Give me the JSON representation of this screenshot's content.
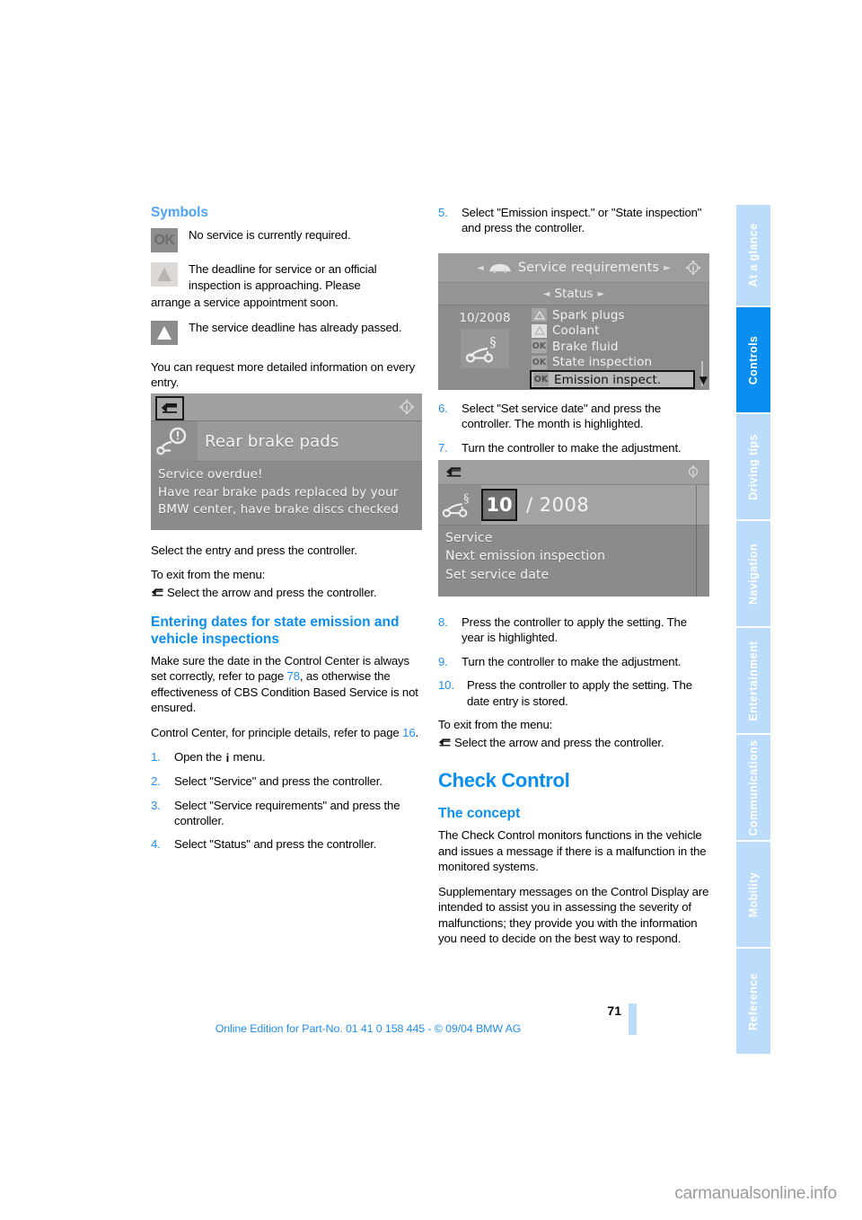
{
  "document": {
    "page_number": "71",
    "footer_line": "Online Edition for Part-No. 01 41 0 158 445 - © 09/04 BMW AG",
    "watermark": "carmanualsonline.info"
  },
  "tabs": [
    {
      "label": "At a glance",
      "active": false
    },
    {
      "label": "Controls",
      "active": true
    },
    {
      "label": "Driving tips",
      "active": false
    },
    {
      "label": "Navigation",
      "active": false
    },
    {
      "label": "Entertainment",
      "active": false
    },
    {
      "label": "Communications",
      "active": false
    },
    {
      "label": "Mobility",
      "active": false
    },
    {
      "label": "Reference",
      "active": false
    }
  ],
  "left_column": {
    "symbols_heading": "Symbols",
    "symbols": [
      {
        "icon": "ok-badge-icon",
        "glyph": "OK",
        "text": "No service is currently required."
      },
      {
        "icon": "warning-triangle-pale-icon",
        "glyph": "",
        "text": "The deadline for service or an official inspection is approaching. Please"
      },
      {
        "icon": "warning-triangle-icon",
        "glyph": "",
        "text": "The service deadline has already passed."
      }
    ],
    "symbol2_overflow": "arrange a service appointment soon.",
    "detail_note": "You can request more detailed information on every entry.",
    "shot1": {
      "title": "Rear brake pads",
      "message_line1": "Service overdue!",
      "message_line2": "Have rear brake pads replaced by your",
      "message_line3": "BMW center, have brake discs checked"
    },
    "after_shot1_1": "Select the entry and press the controller.",
    "after_shot1_2": "To exit from the menu:",
    "after_shot1_3": "Select the arrow and press the controller.",
    "entering_heading": "Entering dates for state emission and vehicle inspections",
    "para1_a": "Make sure the date in the Control Center is always set correctly, refer to page ",
    "para1_page": "78",
    "para1_b": ", as otherwise the effectiveness of CBS Condition Based Service is not ensured.",
    "para2_a": "Control Center, for principle details, refer to page ",
    "para2_page": "16",
    "para2_b": ".",
    "steps": [
      {
        "num": "1.",
        "text_before": "Open the ",
        "icon": "info-i-icon",
        "text_after": " menu."
      },
      {
        "num": "2.",
        "text": "Select \"Service\" and press the controller."
      },
      {
        "num": "3.",
        "text": "Select \"Service requirements\" and press the controller."
      },
      {
        "num": "4.",
        "text": "Select \"Status\" and press the controller."
      }
    ]
  },
  "right_column": {
    "step5": {
      "num": "5.",
      "text": "Select \"Emission inspect.\" or \"State inspection\" and press the controller."
    },
    "shot2": {
      "header": "Service requirements",
      "subheader": "Status",
      "date": "10/2008",
      "items": [
        {
          "badge": "warning",
          "badge_text": "",
          "label": "Spark plugs"
        },
        {
          "badge": "warning-pale",
          "badge_text": "",
          "label": "Coolant"
        },
        {
          "badge": "ok",
          "badge_text": "OK",
          "label": "Brake fluid"
        },
        {
          "badge": "ok",
          "badge_text": "OK",
          "label": "State inspection"
        },
        {
          "badge": "ok",
          "badge_text": "OK",
          "label": "Emission inspect.",
          "selected": true
        }
      ]
    },
    "step6": {
      "num": "6.",
      "text": "Select \"Set service date\" and press the controller. The month is highlighted."
    },
    "step7": {
      "num": "7.",
      "text": "Turn the controller to make the adjustment."
    },
    "shot3": {
      "month": "10",
      "year": "/ 2008",
      "menu": [
        "Service",
        "Next emission inspection",
        "Set service date"
      ]
    },
    "step8": {
      "num": "8.",
      "text": "Press the controller to apply the setting. The year is highlighted."
    },
    "step9": {
      "num": "9.",
      "text": "Turn the controller to make the adjustment."
    },
    "step10": {
      "num": "10.",
      "text": "Press the controller to apply the setting. The date entry is stored."
    },
    "exit_1": "To exit from the menu:",
    "exit_2": "Select the arrow and press the controller.",
    "check_control_heading": "Check Control",
    "concept_heading": "The concept",
    "concept_p1": "The Check Control monitors functions in the vehicle and issues a message if there is a malfunction in the monitored systems.",
    "concept_p2": "Supplementary messages on the Control Display are intended to assist you in assessing the severity of malfunctions; they provide you with the information you need to decide on the best way to respond."
  },
  "colors": {
    "accent_blue": "#0a8ff0",
    "light_blue": "#bcdcfb",
    "heading_blue": "#4da3f7"
  }
}
